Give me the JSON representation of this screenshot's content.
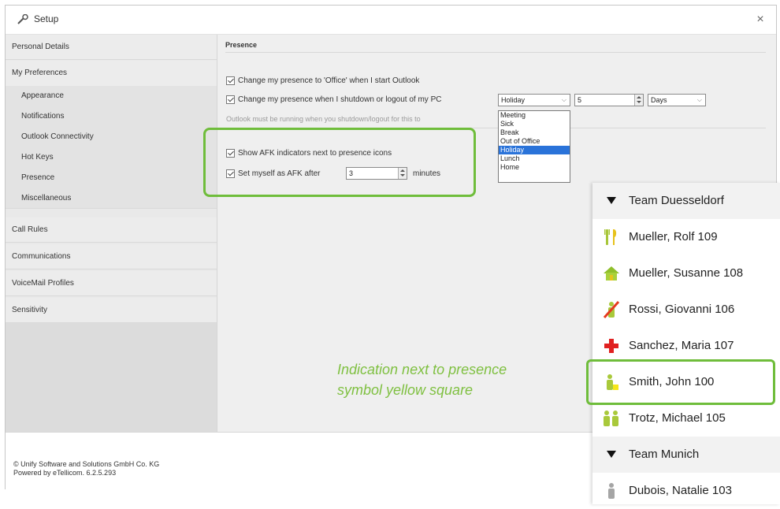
{
  "window": {
    "title": "Setup",
    "close_label": "×"
  },
  "sidebar": {
    "personal_details": "Personal Details",
    "my_preferences": "My Preferences",
    "sub_items": [
      "Appearance",
      "Notifications",
      "Outlook Connectivity",
      "Hot Keys",
      "Presence",
      "Miscellaneous"
    ],
    "call_rules": "Call Rules",
    "communications": "Communications",
    "voicemail_profiles": "VoiceMail Profiles",
    "sensitivity": "Sensitivity"
  },
  "presence": {
    "section_title": "Presence",
    "office_on_start": "Change my presence to 'Office' when I start Outlook",
    "change_on_shutdown": "Change my presence when I shutdown or logout of my PC",
    "presence_select": "Holiday",
    "duration_value": "5",
    "duration_unit": "Days",
    "hint": "Outlook must be running when you shutdown/logout for this to",
    "dropdown_options": [
      "Meeting",
      "Sick",
      "Break",
      "Out of Office",
      "Holiday",
      "Lunch",
      "Home"
    ],
    "dropdown_selected": "Holiday",
    "afk_indicators": "Show AFK indicators next to presence icons",
    "afk_after_prefix": "Set myself as AFK after",
    "afk_minutes_value": "3",
    "afk_minutes_label": "minutes"
  },
  "annotation": {
    "line1": "Indication next to presence",
    "line2": "symbol  yellow square"
  },
  "footer": {
    "line1": "© Unify Software and Solutions GmbH  Co. KG",
    "line2": "Powered by eTellicom.  6.2.5.293"
  },
  "contacts": {
    "team1": "Team Duesseldorf",
    "team2": "Team Munich",
    "people": [
      {
        "name": "Mueller, Rolf  109",
        "icon": "fork-knife-icon"
      },
      {
        "name": "Mueller, Susanne  108",
        "icon": "home-icon"
      },
      {
        "name": "Rossi, Giovanni  106",
        "icon": "out-of-office-icon"
      },
      {
        "name": "Sanchez, Maria  107",
        "icon": "red-cross-icon"
      },
      {
        "name": "Smith, John  100",
        "icon": "available-afk-icon"
      },
      {
        "name": "Trotz, Michael  105",
        "icon": "meeting-icon"
      },
      {
        "name": "Dubois, Natalie  103",
        "icon": "offline-icon"
      }
    ]
  },
  "colors": {
    "accent_green": "#6fbd3b",
    "selection_blue": "#2a73d9",
    "afk_yellow": "#f5e61a"
  }
}
